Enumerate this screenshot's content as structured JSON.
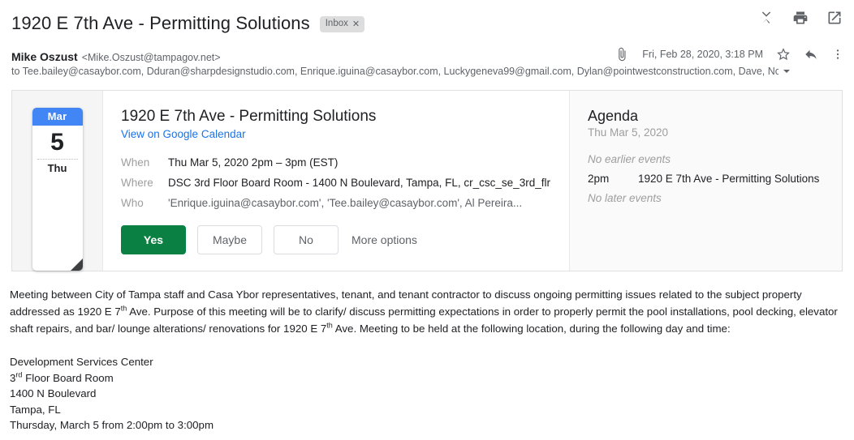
{
  "header": {
    "subject": "1920 E 7th Ave - Permitting Solutions",
    "label_chip": "Inbox",
    "chip_remove": "✕",
    "actions": [
      {
        "name": "collapse-all-icon",
        "label": "Collapse all"
      },
      {
        "name": "print-icon",
        "label": "Print all"
      },
      {
        "name": "open-in-new-window-icon",
        "label": "In new window"
      }
    ]
  },
  "message": {
    "sender_name": "Mike Oszust",
    "sender_email": "<Mike.Oszust@tampagov.net>",
    "date": "Fri, Feb 28, 2020, 3:18 PM",
    "recipients": "to Tee.bailey@casaybor.com, Dduran@sharpdesignstudio.com, Enrique.iguina@casaybor.com, Luckygeneva99@gmail.com, Dylan@pointwestconstruction.com, Dave, Nc",
    "attachment_icon": "paperclip-icon",
    "star_icon": "star-icon",
    "reply_icon": "reply-icon",
    "more_icon": "more-options-icon"
  },
  "invite": {
    "calendar": {
      "month": "Mar",
      "day": "5",
      "weekday": "Thu",
      "header_color": "#4285f4"
    },
    "event_title": "1920 E 7th Ave - Permitting Solutions",
    "calendar_link": "View on Google Calendar",
    "details": [
      {
        "label": "When",
        "value": "Thu Mar 5, 2020 2pm – 3pm (EST)",
        "muted": false
      },
      {
        "label": "Where",
        "value": "DSC 3rd Floor Board Room - 1400 N Boulevard, Tampa, FL, cr_csc_se_3rd_flr",
        "muted": false
      },
      {
        "label": "Who",
        "value": "'Enrique.iguina@casaybor.com', 'Tee.bailey@casaybor.com', Al Pereira...",
        "muted": true
      }
    ],
    "rsvp": {
      "yes": "Yes",
      "maybe": "Maybe",
      "no": "No",
      "more": "More options",
      "yes_color": "#0b8043"
    },
    "agenda": {
      "title": "Agenda",
      "date": "Thu Mar 5, 2020",
      "no_earlier": "No earlier events",
      "no_later": "No later events",
      "events": [
        {
          "time": "2pm",
          "name": "1920 E 7th Ave - Permitting Solutions"
        }
      ]
    }
  },
  "body": {
    "para1_a": "Meeting between City of Tampa staff and Casa Ybor representatives, tenant, and tenant contractor to discuss ongoing permitting issues related to the subject property addressed as 1920 E 7",
    "para1_sup1": "th",
    "para1_b": " Ave. Purpose of this meeting will be to clarify/ discuss permitting expectations in order to properly permit the pool installations, pool decking, elevator shaft repairs, and bar/ lounge alterations/ renovations for 1920 E 7",
    "para1_sup2": "th",
    "para1_c": " Ave. Meeting to be held at the following location, during the following day and time:",
    "address": {
      "line1": "Development Services Center",
      "line2_num": "3",
      "line2_sup": "rd",
      "line2_rest": " Floor Board Room",
      "line3": "1400 N Boulevard",
      "line4": "Tampa, FL",
      "line5": "Thursday, March 5 from 2:00pm to 3:00pm"
    }
  }
}
